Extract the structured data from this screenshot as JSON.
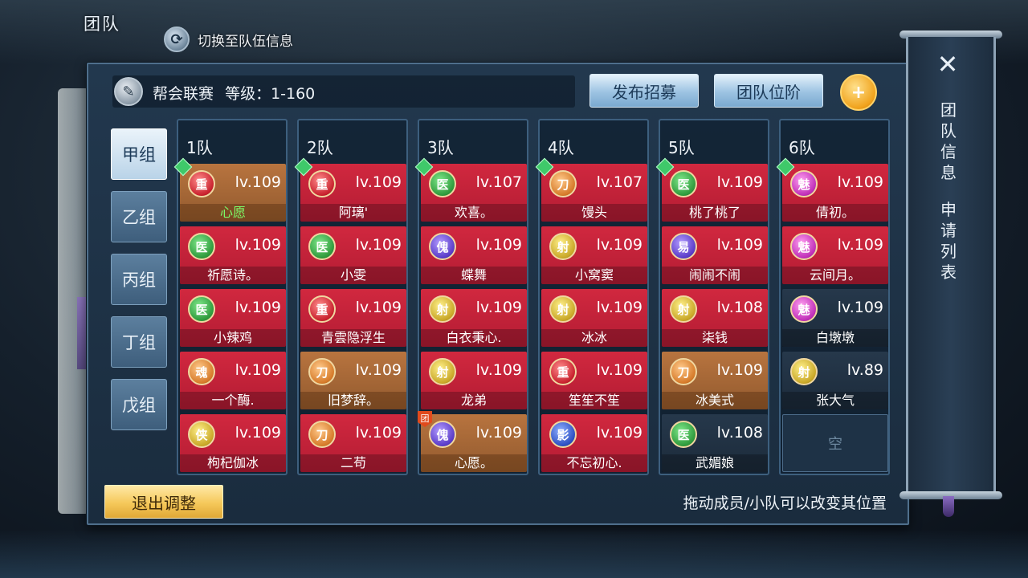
{
  "top": {
    "title": "团队",
    "switch_label": "切换至队伍信息"
  },
  "header": {
    "event_label": "帮会联赛",
    "level_label": "等级：1-160",
    "recruit_button": "发布招募",
    "rank_button": "团队位阶",
    "add_icon": "add-friend-icon"
  },
  "groups": [
    {
      "label": "甲组",
      "active": true
    },
    {
      "label": "乙组",
      "active": false
    },
    {
      "label": "丙组",
      "active": false
    },
    {
      "label": "丁组",
      "active": false
    },
    {
      "label": "戊组",
      "active": false
    }
  ],
  "teams": [
    {
      "title": "1队",
      "members": [
        {
          "name": "心愿",
          "level": "lv.109",
          "job": "重",
          "color": "r",
          "style": "orange",
          "captain": true
        },
        {
          "name": "祈愿诗。",
          "level": "lv.109",
          "job": "医",
          "color": "g",
          "style": "red"
        },
        {
          "name": "小辣鸡",
          "level": "lv.109",
          "job": "医",
          "color": "g",
          "style": "red"
        },
        {
          "name": "一个酶.",
          "level": "lv.109",
          "job": "魂",
          "color": "o",
          "style": "red"
        },
        {
          "name": "枸杞伽冰",
          "level": "lv.109",
          "job": "侠",
          "color": "y",
          "style": "red"
        }
      ]
    },
    {
      "title": "2队",
      "members": [
        {
          "name": "阿璃'",
          "level": "lv.109",
          "job": "重",
          "color": "r",
          "style": "red",
          "captain": true
        },
        {
          "name": "小雯",
          "level": "lv.109",
          "job": "医",
          "color": "g",
          "style": "red"
        },
        {
          "name": "青雲隐浮生",
          "level": "lv.109",
          "job": "重",
          "color": "r",
          "style": "red"
        },
        {
          "name": "旧梦辞。",
          "level": "lv.109",
          "job": "刀",
          "color": "o",
          "style": "orange"
        },
        {
          "name": "二苟",
          "level": "lv.109",
          "job": "刀",
          "color": "o",
          "style": "red"
        }
      ]
    },
    {
      "title": "3队",
      "members": [
        {
          "name": "欢喜。",
          "level": "lv.107",
          "job": "医",
          "color": "g",
          "style": "red",
          "captain": true
        },
        {
          "name": "蝶舞",
          "level": "lv.109",
          "job": "傀",
          "color": "p",
          "style": "red"
        },
        {
          "name": "白衣秉心.",
          "level": "lv.109",
          "job": "射",
          "color": "y",
          "style": "red"
        },
        {
          "name": "龙弟",
          "level": "lv.109",
          "job": "射",
          "color": "y",
          "style": "red"
        },
        {
          "name": "心愿。",
          "level": "lv.109",
          "job": "傀",
          "color": "p",
          "style": "orange",
          "tuan": "团"
        }
      ]
    },
    {
      "title": "4队",
      "members": [
        {
          "name": "馒头",
          "level": "lv.107",
          "job": "刀",
          "color": "o",
          "style": "red",
          "captain": true
        },
        {
          "name": "小窝窦",
          "level": "lv.109",
          "job": "射",
          "color": "y",
          "style": "red"
        },
        {
          "name": "冰冰",
          "level": "lv.109",
          "job": "射",
          "color": "y",
          "style": "red"
        },
        {
          "name": "笙笙不笙",
          "level": "lv.109",
          "job": "重",
          "color": "r",
          "style": "red"
        },
        {
          "name": "不忘初心.",
          "level": "lv.109",
          "job": "影",
          "color": "b",
          "style": "red"
        }
      ]
    },
    {
      "title": "5队",
      "members": [
        {
          "name": "桃了桃了",
          "level": "lv.109",
          "job": "医",
          "color": "g",
          "style": "red",
          "captain": true
        },
        {
          "name": "闹闹不闹",
          "level": "lv.109",
          "job": "易",
          "color": "p",
          "style": "red"
        },
        {
          "name": "柒钱",
          "level": "lv.108",
          "job": "射",
          "color": "y",
          "style": "red"
        },
        {
          "name": "冰美式",
          "level": "lv.109",
          "job": "刀",
          "color": "o",
          "style": "orange"
        },
        {
          "name": "武媚娘",
          "level": "lv.108",
          "job": "医",
          "color": "g",
          "style": "dark"
        }
      ]
    },
    {
      "title": "6队",
      "members": [
        {
          "name": "倩初。",
          "level": "lv.109",
          "job": "魅",
          "color": "m",
          "style": "red",
          "captain": true
        },
        {
          "name": "云间月。",
          "level": "lv.109",
          "job": "魅",
          "color": "m",
          "style": "red"
        },
        {
          "name": "白墩墩",
          "level": "lv.109",
          "job": "魅",
          "color": "m",
          "style": "dark"
        },
        {
          "name": "张大气",
          "level": "lv.89",
          "job": "射",
          "color": "y",
          "style": "dark"
        },
        {
          "empty": true,
          "name": "空"
        }
      ]
    }
  ],
  "footer": {
    "exit_button": "退出调整",
    "hint": "拖动成员/小队可以改变其位置"
  },
  "side": {
    "close_icon": "close-icon",
    "info_label": "团队信息",
    "apply_label": "申请列表"
  }
}
